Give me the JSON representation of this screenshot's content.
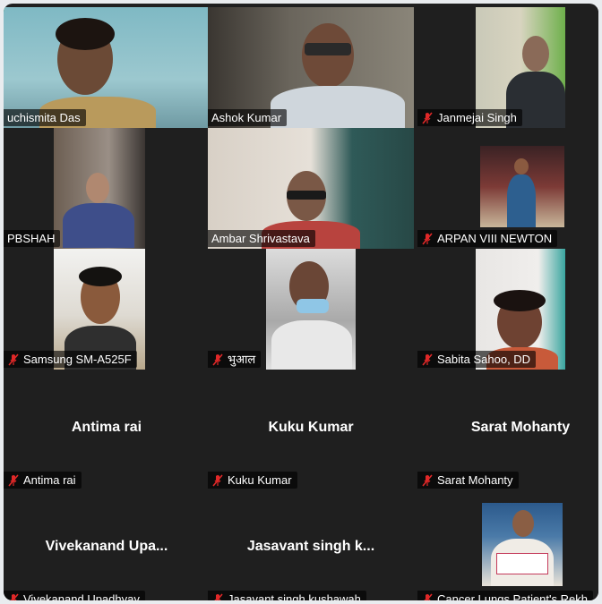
{
  "participants": [
    {
      "name": "Suchismita Das",
      "display_name": "uchismita Das",
      "muted": false,
      "video": true,
      "active_speaker": true
    },
    {
      "name": "Ashok Kumar",
      "display_name": "Ashok Kumar",
      "muted": false,
      "video": true
    },
    {
      "name": "Janmejai Singh",
      "display_name": "Janmejai Singh",
      "muted": true,
      "video": true
    },
    {
      "name": "PBSHAH",
      "display_name": "PBSHAH",
      "muted": false,
      "video": true
    },
    {
      "name": "Ambar Shrivastava",
      "display_name": "Ambar Shrivastava",
      "muted": false,
      "video": true
    },
    {
      "name": "ARPAN VIII NEWTON",
      "display_name": "ARPAN VIII NEWTON",
      "muted": true,
      "video": true
    },
    {
      "name": "Samsung SM-A525F",
      "display_name": "Samsung SM-A525F",
      "muted": true,
      "video": true
    },
    {
      "name": "भुआल",
      "display_name": "भुआल",
      "muted": true,
      "video": true
    },
    {
      "name": "Sabita Sahoo, DD",
      "display_name": "Sabita Sahoo, DD",
      "muted": true,
      "video": true
    },
    {
      "name": "Antima rai",
      "display_name": "Antima rai",
      "big_label": "Antima rai",
      "muted": true,
      "video": false
    },
    {
      "name": "Kuku Kumar",
      "display_name": "Kuku Kumar",
      "big_label": "Kuku Kumar",
      "muted": true,
      "video": false
    },
    {
      "name": "Sarat Mohanty",
      "display_name": "Sarat Mohanty",
      "big_label": "Sarat Mohanty",
      "muted": true,
      "video": false
    },
    {
      "name": "Vivekanand Upadhyay",
      "display_name": "Vivekanand Upadhyay",
      "big_label": "Vivekanand  Upa...",
      "muted": true,
      "video": false
    },
    {
      "name": "Jasavant singh kushawah",
      "display_name": "Jasavant singh kushawah",
      "big_label": "Jasavant singh k...",
      "muted": true,
      "video": false
    },
    {
      "name": "Cancer Lungs Patient's Rekha",
      "display_name": "Cancer Lungs Patient's Rekh",
      "muted": true,
      "video": true
    }
  ],
  "colors": {
    "background": "#1f1f1f",
    "active_speaker_border": "#2ecc71",
    "mute_icon": "#e02828",
    "nameplate_text": "#ffffff"
  }
}
